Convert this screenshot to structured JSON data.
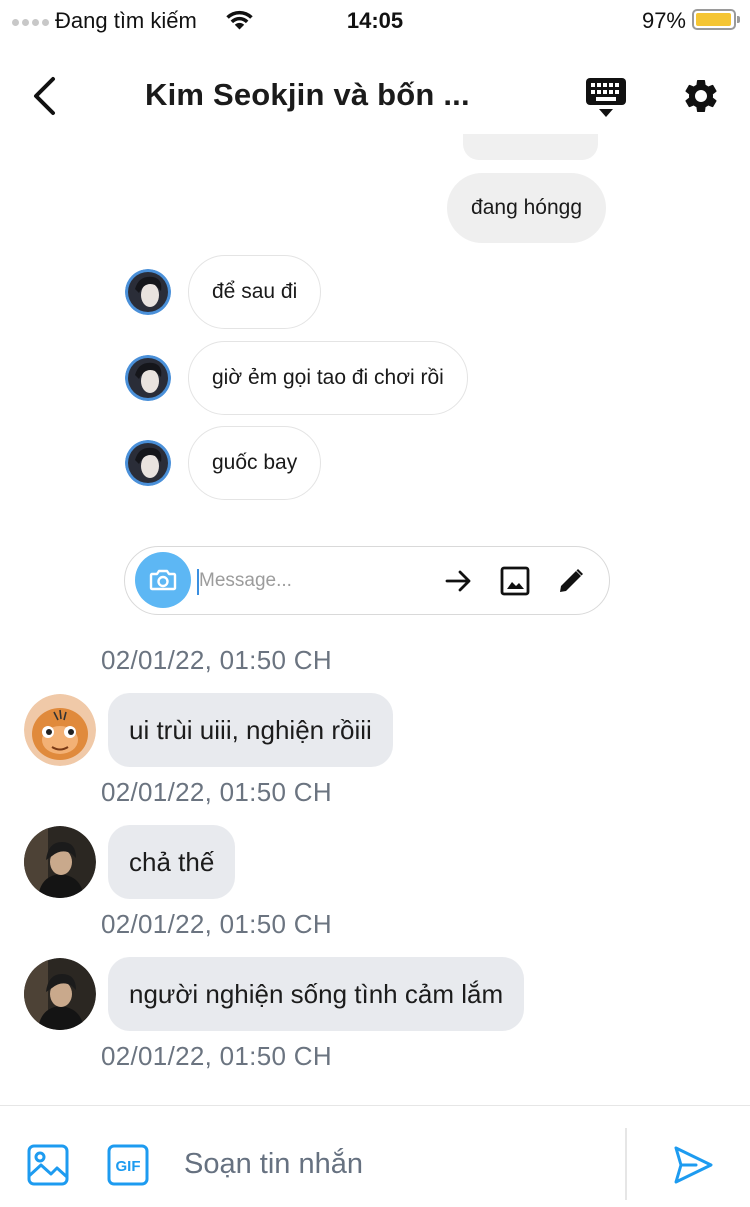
{
  "status_bar": {
    "carrier": "Đang tìm kiếm",
    "time": "14:05",
    "battery": "97%",
    "battery_level": 0.97,
    "battery_color": "#f5c533"
  },
  "header": {
    "title": "Kim Seokjin và bốn ...",
    "back_icon": "chevron-left-icon",
    "keyboard_icon": "keyboard-icon",
    "settings_icon": "gear-icon"
  },
  "group_chat": {
    "outgoing": [
      {
        "text": "đang hóngg"
      }
    ],
    "incoming": [
      {
        "text": "để sau đi"
      },
      {
        "text": "giờ ẻm gọi tao đi chơi rồi"
      },
      {
        "text": "guốc bay"
      }
    ],
    "composer": {
      "placeholder": "Message...",
      "camera_icon": "camera-icon",
      "actions": [
        "arrow-right-icon",
        "image-icon",
        "pencil-icon"
      ]
    }
  },
  "messages": [
    {
      "timestamp": "02/01/22, 01:50 CH"
    },
    {
      "text": "ui trùi uiii, nghiện rồiii",
      "avatar": "orange-cartoon-avatar"
    },
    {
      "timestamp": "02/01/22, 01:50 CH"
    },
    {
      "text": "chả thế",
      "avatar": "dark-photo-avatar"
    },
    {
      "timestamp": "02/01/22, 01:50 CH"
    },
    {
      "text": "người nghiện sống tình cảm lắm",
      "avatar": "dark-photo-avatar"
    },
    {
      "timestamp": "02/01/22, 01:50 CH"
    }
  ],
  "bottom_bar": {
    "placeholder": "Soạn tin nhắn",
    "gif_label": "GIF",
    "accent": "#1d9bf0"
  }
}
